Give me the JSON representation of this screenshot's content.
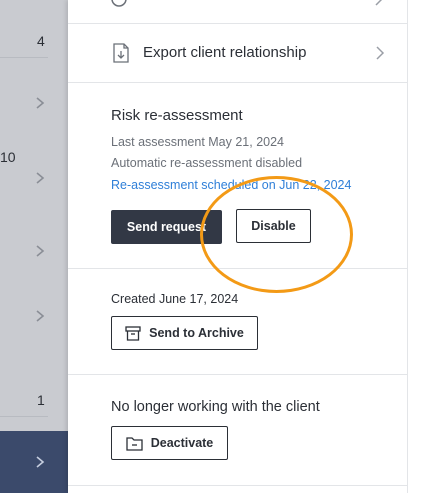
{
  "background": {
    "counts": [
      "4",
      "10",
      "1"
    ]
  },
  "export": {
    "label": "Export client relationship",
    "icon": "file-download-icon"
  },
  "risk": {
    "title": "Risk re-assessment",
    "last_assessment": "Last assessment May 21, 2024",
    "auto_status": "Automatic re-assessment disabled",
    "scheduled_link": "Re-assessment scheduled on Jun 22, 2024",
    "send_request_label": "Send request",
    "disable_label": "Disable"
  },
  "archive": {
    "created": "Created June 17, 2024",
    "button_label": "Send to Archive",
    "icon": "archive-box-icon"
  },
  "deactivate": {
    "title": "No longer working with the client",
    "button_label": "Deactivate",
    "icon": "folder-minus-icon"
  },
  "colors": {
    "primary_button": "#323845",
    "link": "#2f7fd8",
    "annotation": "#f39a16",
    "selected_row": "#3b4a6b"
  }
}
